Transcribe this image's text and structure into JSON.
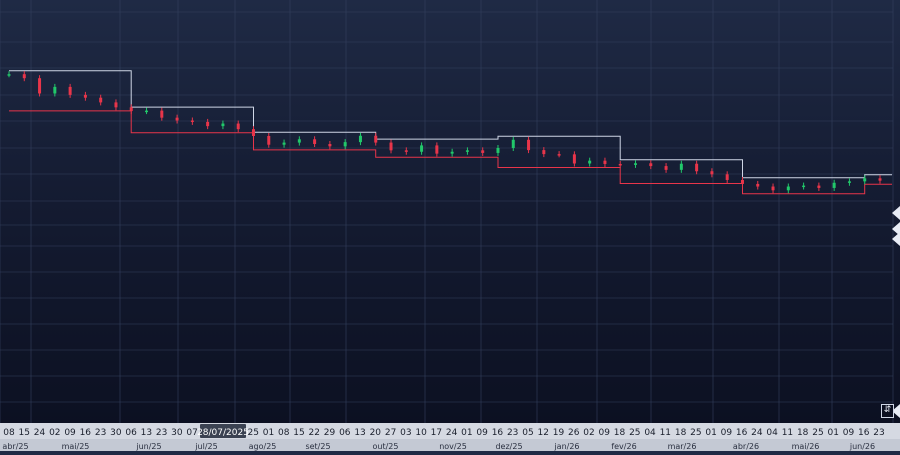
{
  "chart_data": {
    "type": "candlestick",
    "xlabel": "",
    "ylabel": "",
    "grid": true,
    "crosshair_date": "28/07/2025",
    "day_ticks": [
      "08",
      "15",
      "24",
      "02",
      "09",
      "16",
      "23",
      "30",
      "06",
      "13",
      "23",
      "30",
      "07",
      "14",
      "11",
      "18",
      "25",
      "01",
      "08",
      "15",
      "22",
      "29",
      "06",
      "13",
      "20",
      "27",
      "03",
      "10",
      "17",
      "24",
      "01",
      "09",
      "16",
      "23",
      "05",
      "12",
      "19",
      "26",
      "02",
      "09",
      "18",
      "25",
      "04",
      "11",
      "18",
      "25",
      "01",
      "09",
      "16",
      "24",
      "04",
      "11",
      "18",
      "25",
      "01",
      "09",
      "16",
      "23"
    ],
    "month_ticks": [
      "abr/25",
      "mai/25",
      "jun/25",
      "jul/25",
      "ago/25",
      "set/25",
      "out/25",
      "nov/25",
      "dez/25",
      "jan/26",
      "fev/26",
      "mar/26",
      "abr/26",
      "mai/26",
      "jun/26"
    ],
    "ohlc_scale": [
      0,
      100
    ],
    "colors": {
      "up": "#21c86a",
      "down": "#e8354a",
      "grid": "#34405e",
      "text": "#c9d0e0",
      "upper_band": "#cfd6e6",
      "lower_band": "#e8354a"
    },
    "series": [
      {
        "name": "",
        "levels": [
          88.0,
          86.3,
          79.8,
          82.6,
          79.2,
          78.0,
          76.0,
          73.9,
          72.3,
          72.5,
          69.5,
          68.3,
          67.7,
          65.9,
          67.0,
          64.6,
          61.7,
          58.0,
          58.9,
          60.3,
          58.3,
          57.3,
          59.1,
          61.8,
          58.9,
          55.6,
          55.0,
          57.7,
          54.2,
          55.0,
          55.6,
          54.5,
          56.6,
          60.1,
          55.7,
          54.0,
          53.9,
          50.0,
          51.2,
          49.8,
          49.4,
          50.1,
          48.9,
          47.3,
          49.9,
          46.7,
          45.4,
          43.0,
          41.3,
          40.2,
          38.6,
          40.2,
          40.6,
          39.6,
          41.8,
          42.4,
          43.7,
          42.7
        ]
      }
    ]
  }
}
